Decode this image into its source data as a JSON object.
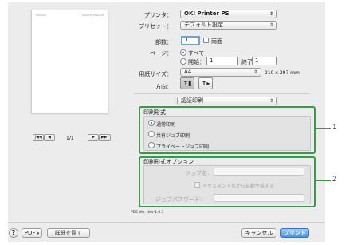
{
  "preview": {
    "header_left": "OKIDATA",
    "header_right": "OKIDATA ENGLISH"
  },
  "pager": {
    "first": "|◀◀",
    "prev": "◀",
    "next": "▶",
    "last": "▶▶|",
    "count": "1/1"
  },
  "printer": {
    "label": "プリンタ：",
    "value": "OKI Printer PS"
  },
  "preset": {
    "label": "プリセット：",
    "value": "デフォルト設定"
  },
  "copies": {
    "label": "部数：",
    "value": "1",
    "duplex_label": "両面"
  },
  "pages": {
    "label": "ページ：",
    "all_label": "すべて",
    "from_label": "開始：",
    "from_value": "1",
    "to_label": "終了：",
    "to_value": "1"
  },
  "paper": {
    "label": "用紙サイズ：",
    "value": "A4",
    "dimensions": "210 x 297 mm"
  },
  "orientation": {
    "label": "方向："
  },
  "panel": {
    "value": "認証印刷"
  },
  "print_mode": {
    "title": "印刷形式",
    "options": [
      "通常印刷",
      "共有ジョブ印刷",
      "プライベートジョブ印刷"
    ]
  },
  "print_mode_options": {
    "title": "印刷形式オプション",
    "job_name_label": "ジョブ名:",
    "auto_name_label": "ドキュメント名から自動生成する",
    "password_label": "ジョブパスワード:"
  },
  "callouts": {
    "one": "1",
    "two": "2"
  },
  "version": "PDE Ver. dev-1.0.1",
  "footer": {
    "help": "?",
    "pdf": "PDF",
    "hide_details": "詳細を隠す",
    "cancel": "キャンセル",
    "print": "プリント"
  }
}
